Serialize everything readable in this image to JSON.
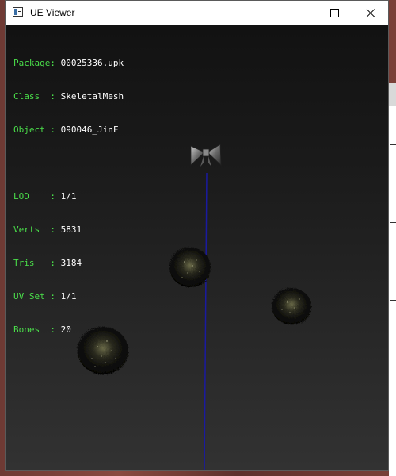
{
  "window": {
    "title": "UE Viewer"
  },
  "info": {
    "rows": [
      {
        "label": "Package: ",
        "value": "00025336.upk"
      },
      {
        "label": "Class  : ",
        "value": "SkeletalMesh"
      },
      {
        "label": "Object : ",
        "value": "090046_JinF"
      }
    ],
    "mesh_rows": [
      {
        "label": "LOD    : ",
        "value": "1/1"
      },
      {
        "label": "Verts  : ",
        "value": "5831"
      },
      {
        "label": "Tris   : ",
        "value": "3184"
      },
      {
        "label": "UV Set : ",
        "value": "1/1"
      },
      {
        "label": "Bones  : ",
        "value": "20"
      }
    ]
  },
  "colors": {
    "label": "#4ade4a",
    "value": "#ffffff",
    "bone_line": "#1a1aa0"
  },
  "icons": {
    "app": "window-icon",
    "minimize": "minimize-icon",
    "maximize": "maximize-icon",
    "close": "close-icon",
    "bow": "bow-mesh-icon"
  }
}
